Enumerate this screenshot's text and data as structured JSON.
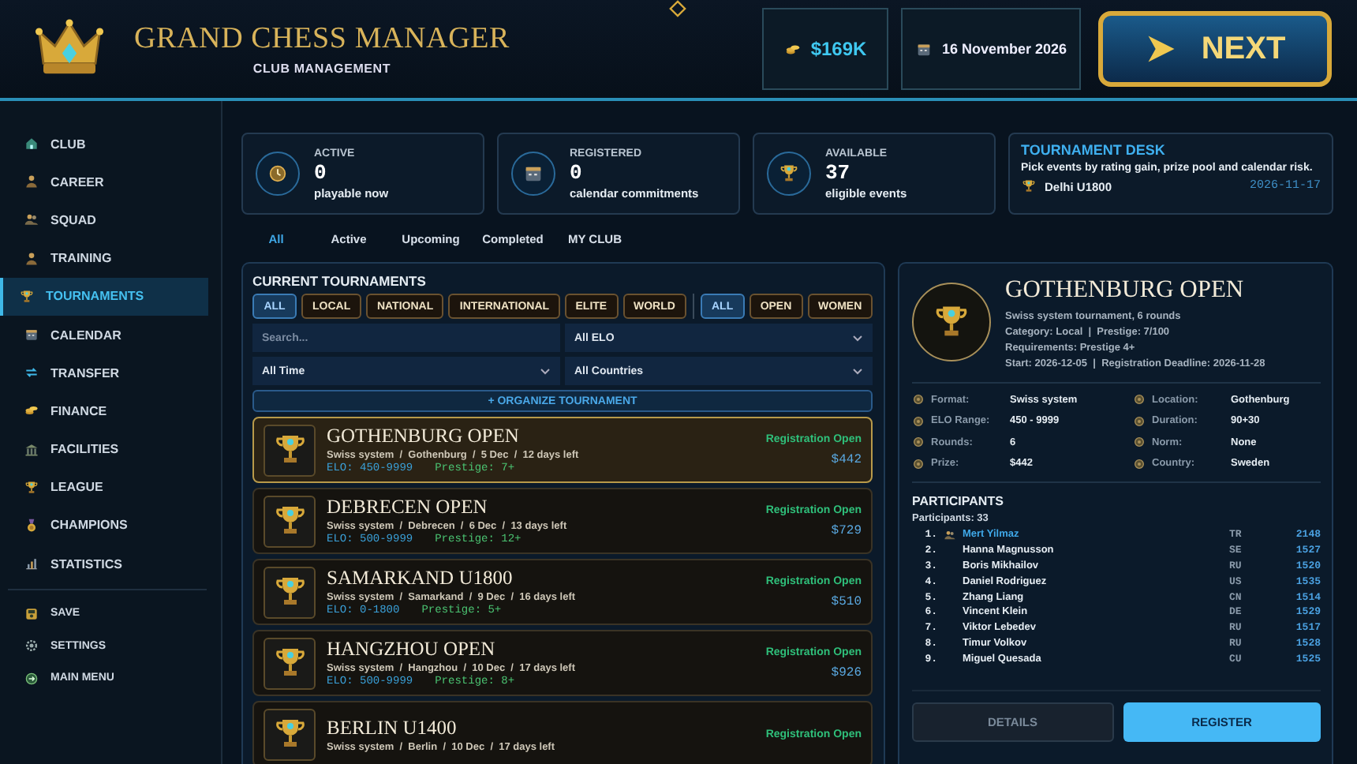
{
  "header": {
    "title": "GRAND CHESS MANAGER",
    "subtitle": "CLUB MANAGEMENT",
    "money": "$169K",
    "date": "16 November 2026",
    "next_button": "NEXT"
  },
  "sidebar": {
    "items": [
      {
        "label": "CLUB",
        "kind": "house",
        "selected": false
      },
      {
        "label": "CAREER",
        "kind": "person",
        "selected": false
      },
      {
        "label": "SQUAD",
        "kind": "people",
        "selected": false
      },
      {
        "label": "TRAINING",
        "kind": "person",
        "selected": false
      },
      {
        "label": "TOURNAMENTS",
        "kind": "trophy",
        "selected": true
      },
      {
        "label": "CALENDAR",
        "kind": "calendar",
        "selected": false
      },
      {
        "label": "TRANSFER",
        "kind": "arrows",
        "selected": false
      },
      {
        "label": "FINANCE",
        "kind": "coins",
        "selected": false
      },
      {
        "label": "FACILITIES",
        "kind": "building",
        "selected": false
      },
      {
        "label": "LEAGUE",
        "kind": "trophy",
        "selected": false
      },
      {
        "label": "CHAMPIONS",
        "kind": "medal",
        "selected": false
      },
      {
        "label": "STATISTICS",
        "kind": "chart",
        "selected": false
      }
    ],
    "footer_items": [
      {
        "label": "SAVE",
        "kind": "disk"
      },
      {
        "label": "SETTINGS",
        "kind": "gear"
      },
      {
        "label": "MAIN MENU",
        "kind": "exit"
      }
    ]
  },
  "stats": [
    {
      "kind": "clock",
      "label": "ACTIVE",
      "value": "0",
      "caption": "playable now"
    },
    {
      "kind": "calendar",
      "label": "REGISTERED",
      "value": "0",
      "caption": "calendar commitments"
    },
    {
      "kind": "trophy",
      "label": "AVAILABLE",
      "value": "37",
      "caption": "eligible events"
    }
  ],
  "desk": {
    "title": "TOURNAMENT DESK",
    "text": "Pick events by rating gain, prize pool and calendar risk.",
    "event": "Delhi U1800",
    "date": "2026-11-17"
  },
  "tabs": [
    {
      "label": "All",
      "selected": true
    },
    {
      "label": "Active",
      "selected": false
    },
    {
      "label": "Upcoming",
      "selected": false
    },
    {
      "label": "Completed",
      "selected": false
    },
    {
      "label": "MY CLUB",
      "selected": false
    }
  ],
  "tournaments_panel": {
    "title": "CURRENT TOURNAMENTS",
    "category_filters": [
      {
        "label": "ALL",
        "selected": true
      },
      {
        "label": "LOCAL",
        "selected": false
      },
      {
        "label": "NATIONAL",
        "selected": false
      },
      {
        "label": "INTERNATIONAL",
        "selected": false
      },
      {
        "label": "ELITE",
        "selected": false
      },
      {
        "label": "WORLD",
        "selected": false
      }
    ],
    "type_filters": [
      {
        "label": "ALL",
        "selected": true
      },
      {
        "label": "OPEN",
        "selected": false
      },
      {
        "label": "WOMEN",
        "selected": false
      }
    ],
    "search": {
      "placeholder": "Search..."
    },
    "elo_select": "All ELO",
    "time_select": "All Time",
    "country_select": "All Countries",
    "organize_button": "+ ORGANIZE TOURNAMENT",
    "tournaments": [
      {
        "name": "GOTHENBURG OPEN",
        "meta": "Swiss system  /  Gothenburg  /  5 Dec  /  12 days left",
        "elo": "ELO: 450-9999",
        "prestige": "Prestige: 7+",
        "status": "Registration Open",
        "prize": "$442",
        "selected": true
      },
      {
        "name": "DEBRECEN OPEN",
        "meta": "Swiss system  /  Debrecen  /  6 Dec  /  13 days left",
        "elo": "ELO: 500-9999",
        "prestige": "Prestige: 12+",
        "status": "Registration Open",
        "prize": "$729",
        "selected": false
      },
      {
        "name": "SAMARKAND U1800",
        "meta": "Swiss system  /  Samarkand  /  9 Dec  /  16 days left",
        "elo": "ELO: 0-1800",
        "prestige": "Prestige: 5+",
        "status": "Registration Open",
        "prize": "$510",
        "selected": false
      },
      {
        "name": "HANGZHOU OPEN",
        "meta": "Swiss system  /  Hangzhou  /  10 Dec  /  17 days left",
        "elo": "ELO: 500-9999",
        "prestige": "Prestige: 8+",
        "status": "Registration Open",
        "prize": "$926",
        "selected": false
      },
      {
        "name": "BERLIN U1400",
        "meta": "Swiss system  /  Berlin  /  10 Dec  /  17 days left",
        "status": "Registration Open",
        "selected": false
      }
    ]
  },
  "detail": {
    "name": "GOTHENBURG OPEN",
    "lines": [
      "Swiss system tournament, 6 rounds",
      "Category: Local  |  Prestige: 7/100",
      "Requirements: Prestige 4+",
      "Start: 2026-12-05  |  Registration Deadline: 2026-11-28"
    ],
    "facts": [
      {
        "label": "Format:",
        "value": "Swiss system"
      },
      {
        "label": "Location:",
        "value": "Gothenburg"
      },
      {
        "label": "ELO Range:",
        "value": "450 - 9999"
      },
      {
        "label": "Duration:",
        "value": "90+30"
      },
      {
        "label": "Rounds:",
        "value": "6"
      },
      {
        "label": "Norm:",
        "value": "None"
      },
      {
        "label": "Prize:",
        "value": "$442"
      },
      {
        "label": "Country:",
        "value": "Sweden"
      }
    ],
    "participants_title": "PARTICIPANTS",
    "participants_count": "Participants: 33",
    "participants": [
      {
        "rank": "1.",
        "name": "Mert Yilmaz",
        "country": "TR",
        "rating": "2148",
        "own_club": true
      },
      {
        "rank": "2.",
        "name": "Hanna Magnusson",
        "country": "SE",
        "rating": "1527",
        "own_club": false
      },
      {
        "rank": "3.",
        "name": "Boris Mikhailov",
        "country": "RU",
        "rating": "1520",
        "own_club": false
      },
      {
        "rank": "4.",
        "name": "Daniel Rodriguez",
        "country": "US",
        "rating": "1535",
        "own_club": false
      },
      {
        "rank": "5.",
        "name": "Zhang Liang",
        "country": "CN",
        "rating": "1514",
        "own_club": false
      },
      {
        "rank": "6.",
        "name": "Vincent Klein",
        "country": "DE",
        "rating": "1529",
        "own_club": false
      },
      {
        "rank": "7.",
        "name": "Viktor Lebedev",
        "country": "RU",
        "rating": "1517",
        "own_club": false
      },
      {
        "rank": "8.",
        "name": "Timur Volkov",
        "country": "RU",
        "rating": "1528",
        "own_club": false
      },
      {
        "rank": "9.",
        "name": "Miguel Quesada",
        "country": "CU",
        "rating": "1525",
        "own_club": false
      }
    ],
    "details_button": "DETAILS",
    "register_button": "REGISTER"
  }
}
